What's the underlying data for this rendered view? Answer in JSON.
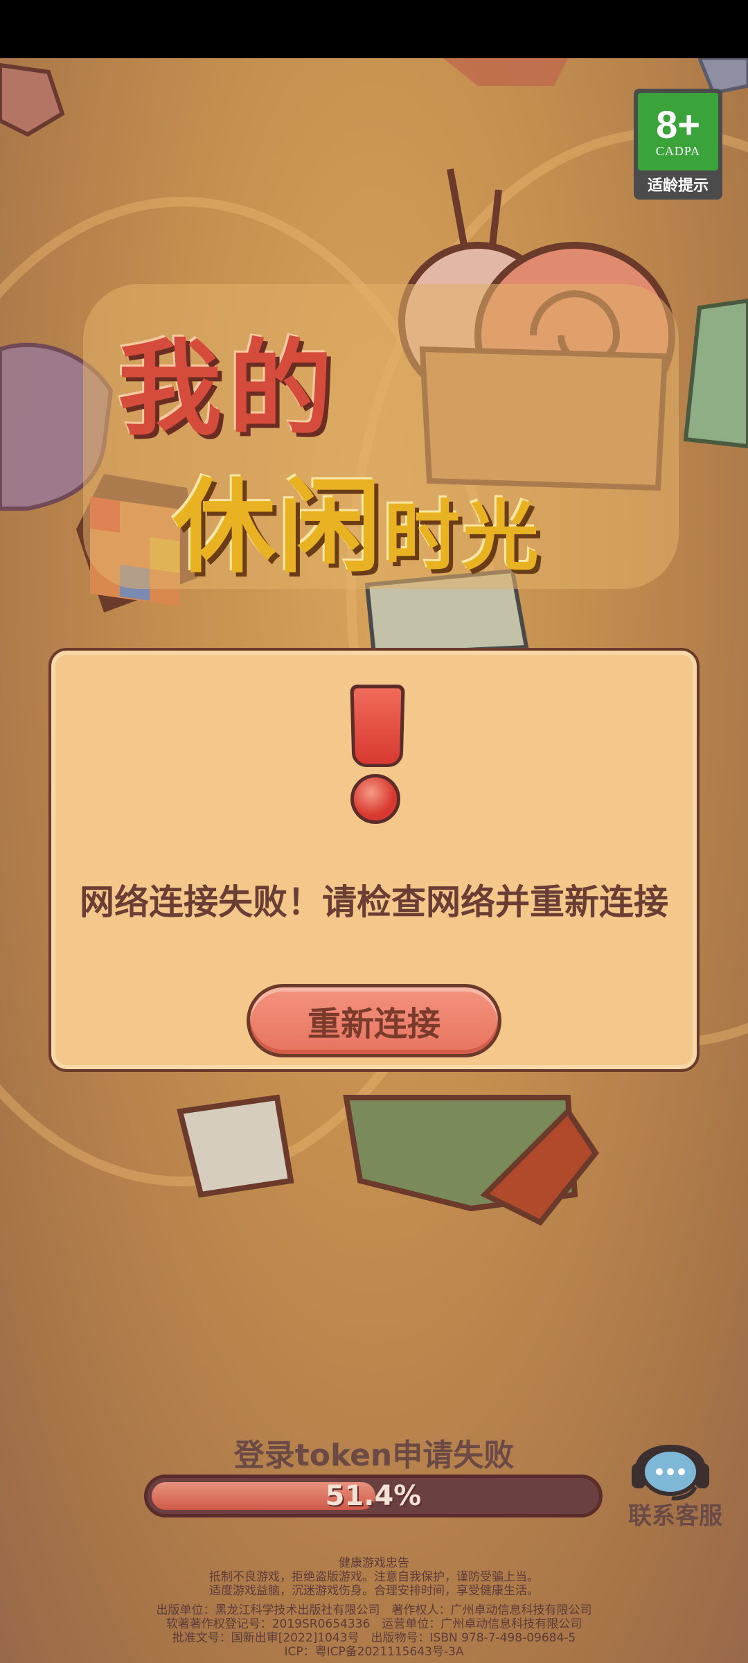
{
  "age_rating": {
    "age": "8+",
    "org": "CADPA",
    "tip": "适龄提示"
  },
  "logo": {
    "line1": "我的",
    "line2_a": "休闲",
    "line2_b": "时光"
  },
  "dialog": {
    "message": "网络连接失败！请检查网络并重新连接",
    "retry_label": "重新连接"
  },
  "progress": {
    "status": "登录token申请失败",
    "value_text": "51.4%",
    "value": 51.4
  },
  "support": {
    "label": "联系客服"
  },
  "footer": {
    "health_title": "健康游戏忠告",
    "health_line1": "抵制不良游戏，拒绝盗版游戏。注意自我保护，谨防受骗上当。",
    "health_line2": "适度游戏益脑，沉迷游戏伤身。合理安排时间，享受健康生活。",
    "publisher": "出版单位：黑龙江科学技术出版社有限公司　著作权人：广州卓动信息科技有限公司",
    "copyright": "软著著作权登记号：2019SR0654336　运营单位：广州卓动信息科技有限公司",
    "approval": "批准文号：国新出审[2022]1043号　出版物号：ISBN 978-7-498-09684-5",
    "icp": "ICP：粤ICP备2021115643号-3A"
  },
  "colors": {
    "dialog_bg": "#f4c78b",
    "button": "#e7745f",
    "warning": "#d8382f",
    "age_green": "#3aa43b"
  }
}
